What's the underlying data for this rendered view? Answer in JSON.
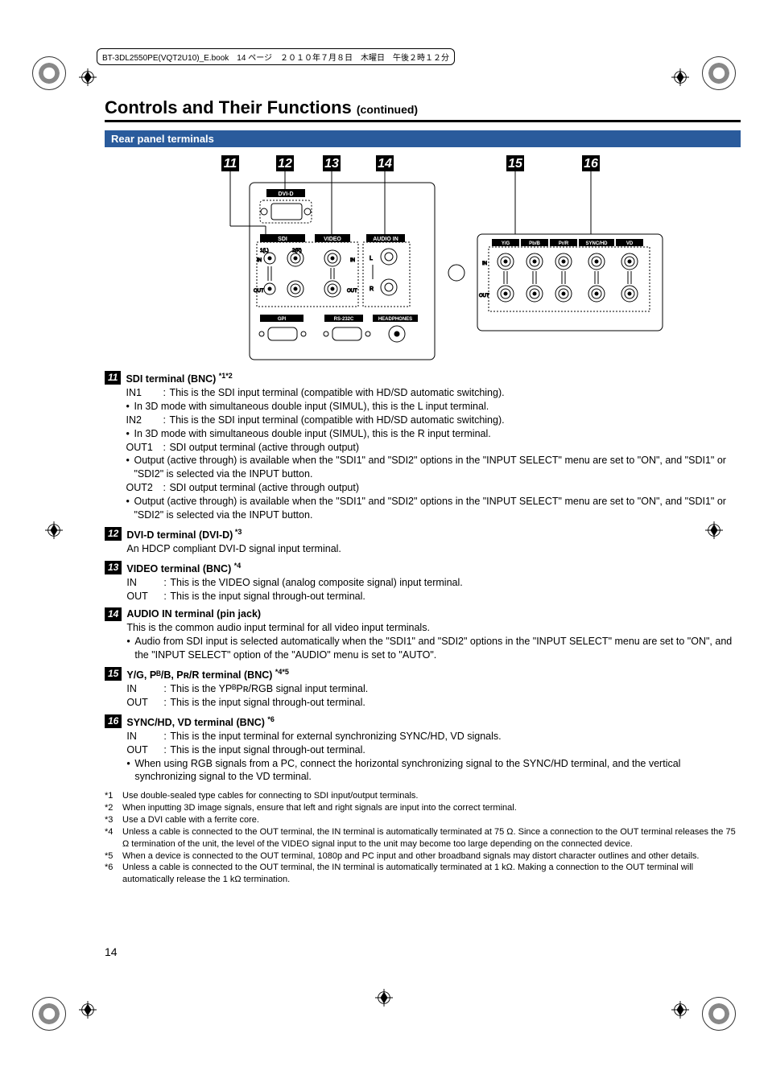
{
  "header_strip": "BT-3DL2550PE(VQT2U10)_E.book　14 ページ　２０１０年７月８日　木曜日　午後２時１２分",
  "heading_main": "Controls and Their Functions ",
  "heading_sub": "(continued)",
  "banner": "Rear panel terminals",
  "diagram": {
    "callouts": [
      "11",
      "12",
      "13",
      "14",
      "15",
      "16"
    ],
    "labels": {
      "dvi_d": "DVI-D",
      "sdi": "SDI",
      "video": "VIDEO",
      "audio_in": "AUDIO IN",
      "in": "IN",
      "out": "OUT",
      "one_l": "1(L)",
      "two_r": "2(R)",
      "l": "L",
      "r": "R",
      "gpi": "GPI",
      "rs232c": "RS-232C",
      "headphones": "HEADPHONES",
      "yg": "Y/G",
      "pbb": "Pᴮ/B",
      "prr": "Pʀ/R",
      "synchd": "SYNC/HD",
      "vd": "VD"
    }
  },
  "items": [
    {
      "num": "11",
      "title_parts": [
        "SDI terminal (BNC) "
      ],
      "sup": "*1*2",
      "body": [
        {
          "type": "row",
          "lbl": "IN1",
          "txt": "This is the SDI input terminal (compatible with HD/SD automatic switching)."
        },
        {
          "type": "bullet",
          "txt": "In 3D mode with simultaneous double input (SIMUL), this is the L input terminal."
        },
        {
          "type": "row",
          "lbl": "IN2",
          "txt": "This is the SDI input terminal (compatible with HD/SD automatic switching)."
        },
        {
          "type": "bullet",
          "txt": "In 3D mode with simultaneous double input (SIMUL), this is the R input terminal."
        },
        {
          "type": "row",
          "lbl": "OUT1",
          "txt": "SDI output terminal (active through output)"
        },
        {
          "type": "bullet",
          "txt": "Output (active through) is available when the \"SDI1\" and \"SDI2\" options in the \"INPUT SELECT\" menu are set to \"ON\", and \"SDI1\" or \"SDI2\" is selected via the INPUT button."
        },
        {
          "type": "row",
          "lbl": "OUT2",
          "txt": "SDI output terminal (active through output)"
        },
        {
          "type": "bullet",
          "txt": "Output (active through) is available when the \"SDI1\" and \"SDI2\" options in the \"INPUT SELECT\" menu are set to \"ON\", and \"SDI1\" or \"SDI2\" is selected via the INPUT button."
        }
      ]
    },
    {
      "num": "12",
      "title_parts": [
        "DVI-D terminal (DVI-D)"
      ],
      "sup": " *3",
      "body": [
        {
          "type": "plain",
          "txt": "An HDCP compliant DVI-D signal input terminal."
        }
      ]
    },
    {
      "num": "13",
      "title_parts": [
        "VIDEO terminal (BNC) "
      ],
      "sup": "*4",
      "body": [
        {
          "type": "row",
          "lbl": "IN",
          "txt": "This is the VIDEO signal (analog composite signal) input terminal."
        },
        {
          "type": "row",
          "lbl": "OUT",
          "txt": "This is the input signal through-out terminal."
        }
      ]
    },
    {
      "num": "14",
      "title_parts": [
        "AUDIO IN terminal (pin jack)"
      ],
      "sup": "",
      "body": [
        {
          "type": "plain",
          "txt": "This is the common audio input terminal for all video input terminals."
        },
        {
          "type": "bullet",
          "txt": "Audio from SDI input is selected automatically when the \"SDI1\" and \"SDI2\" options in the \"INPUT SELECT\" menu are set to \"ON\", and the \"INPUT SELECT\" option of the \"AUDIO\" menu is set to \"AUTO\"."
        }
      ]
    },
    {
      "num": "15",
      "title_parts": [
        "Y/G, Pᴮ/B, Pʀ/R terminal (BNC) "
      ],
      "sup": "*4*5",
      "body": [
        {
          "type": "row",
          "lbl": "IN",
          "txt": "This is the YPᴮPʀ/RGB signal input terminal."
        },
        {
          "type": "row",
          "lbl": "OUT",
          "txt": "This is the input signal through-out terminal."
        }
      ]
    },
    {
      "num": "16",
      "title_parts": [
        "SYNC/HD, VD terminal (BNC) "
      ],
      "sup": "*6",
      "body": [
        {
          "type": "row",
          "lbl": "IN",
          "txt": "This is the input terminal for external synchronizing SYNC/HD, VD signals."
        },
        {
          "type": "row",
          "lbl": "OUT",
          "txt": "This is the input signal through-out terminal."
        },
        {
          "type": "bullet",
          "txt": "When using RGB signals from a PC, connect the horizontal synchronizing signal to the SYNC/HD terminal, and the vertical synchronizing signal to the VD terminal."
        }
      ]
    }
  ],
  "footnotes": [
    {
      "m": "*1",
      "t": "Use double-sealed type cables for connecting to SDI input/output terminals."
    },
    {
      "m": "*2",
      "t": "When inputting 3D image signals, ensure that left and right signals are input into the correct terminal."
    },
    {
      "m": "*3",
      "t": "Use a DVI cable with a ferrite core."
    },
    {
      "m": "*4",
      "t": "Unless a cable is connected to the OUT terminal, the IN terminal is automatically terminated at 75 Ω. Since a connection to the OUT terminal releases the 75 Ω termination of the unit, the level of the VIDEO signal input to the unit may become too large depending on the connected device."
    },
    {
      "m": "*5",
      "t": "When a device is connected to the OUT terminal, 1080p and PC input and other broadband signals may distort character outlines and other details."
    },
    {
      "m": "*6",
      "t": "Unless a cable is connected to the OUT terminal, the IN terminal is automatically terminated at 1 kΩ. Making a connection to the OUT terminal will automatically release the 1 kΩ termination."
    }
  ],
  "page_number": "14"
}
